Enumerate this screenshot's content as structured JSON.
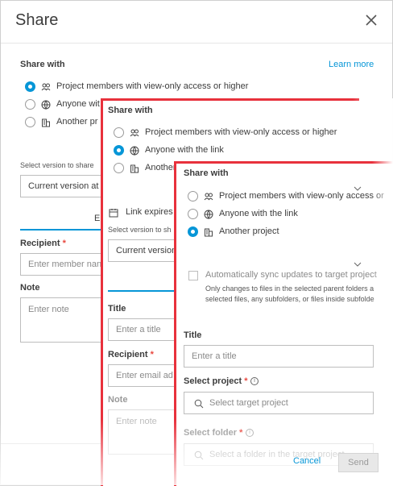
{
  "dialog": {
    "title": "Share",
    "share_with_label": "Share with",
    "learn_more": "Learn more",
    "options": [
      "Project members with view-only access or higher",
      "Anyone wit",
      "Another pr"
    ],
    "select_version_label": "Select version to share",
    "version_value": "Current version at",
    "tab_partial": "E",
    "recipient_label": "Recipient",
    "recipient_placeholder": "Enter member nan",
    "note_label": "Note",
    "note_placeholder": "Enter note",
    "cancel": "Cancel",
    "send": "Send"
  },
  "overlay1": {
    "share_with_label": "Share with",
    "options": [
      "Project members with view-only access or higher",
      "Anyone with the link",
      "Another"
    ],
    "link_expires": "Link expires",
    "select_version_label": "Select version to sh",
    "version_value": "Current version",
    "title_label": "Title",
    "title_placeholder": "Enter a title",
    "recipient_label": "Recipient",
    "recipient_placeholder": "Enter email ad",
    "note_label": "Note",
    "note_placeholder": "Enter note"
  },
  "overlay2": {
    "share_with_label": "Share with",
    "options": [
      "Project members with view-only access or",
      "Anyone with the link",
      "Another project"
    ],
    "sync_label": "Automatically sync updates to target project",
    "sync_desc_1": "Only changes to files in the selected parent folders a",
    "sync_desc_2": "selected files, any subfolders, or files inside subfolde",
    "title_label": "Title",
    "title_placeholder": "Enter a title",
    "select_project_label": "Select project",
    "project_placeholder": "Select target project",
    "select_folder_label": "Select folder",
    "folder_placeholder": "Select a folder in the target project"
  },
  "colors": {
    "accent": "#0696d7",
    "highlight": "#e8313c",
    "required": "#e8473e"
  }
}
